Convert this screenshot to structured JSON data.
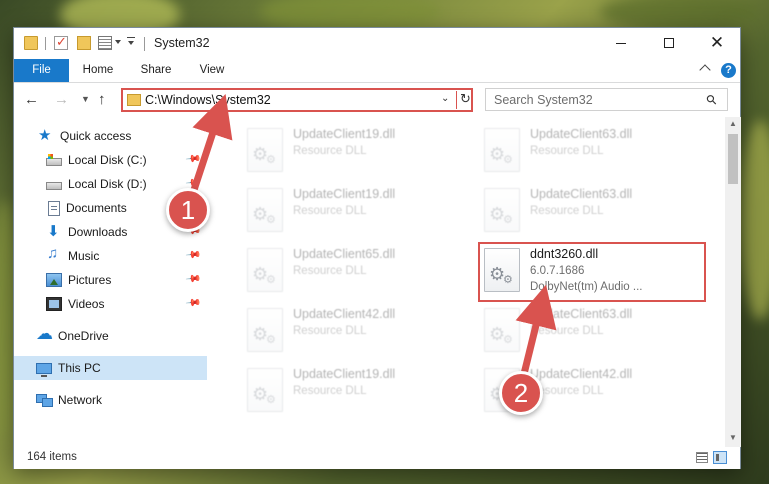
{
  "window": {
    "title": "System32",
    "minimize_label": "—",
    "close_label": "✕"
  },
  "ribbon": {
    "tabs": [
      "File",
      "Home",
      "Share",
      "View"
    ],
    "help_label": "?"
  },
  "nav": {
    "address": "C:\\Windows\\System32",
    "search_placeholder": "Search System32"
  },
  "sidebar": {
    "items": [
      {
        "label": "Quick access",
        "icon": "star-icon",
        "pinned": false
      },
      {
        "label": "Local Disk (C:)",
        "icon": "drive-icon",
        "pinned": true
      },
      {
        "label": "Local Disk (D:)",
        "icon": "drive-icon",
        "pinned": true
      },
      {
        "label": "Documents",
        "icon": "documents-icon",
        "pinned": true
      },
      {
        "label": "Downloads",
        "icon": "downloads-icon",
        "pinned": true
      },
      {
        "label": "Music",
        "icon": "music-icon",
        "pinned": true
      },
      {
        "label": "Pictures",
        "icon": "pictures-icon",
        "pinned": true
      },
      {
        "label": "Videos",
        "icon": "videos-icon",
        "pinned": true
      },
      {
        "label": "OneDrive",
        "icon": "onedrive-icon",
        "pinned": false
      },
      {
        "label": "This PC",
        "icon": "this-pc-icon",
        "pinned": false,
        "selected": true
      },
      {
        "label": "Network",
        "icon": "network-icon",
        "pinned": false
      }
    ]
  },
  "files": [
    {
      "name": "UpdateClient19.dll",
      "type": "Resource DLL",
      "faded": true
    },
    {
      "name": "UpdateClient63.dll",
      "type": "Resource DLL",
      "faded": true
    },
    {
      "name": "UpdateClient19.dll",
      "type": "Resource DLL",
      "faded": true
    },
    {
      "name": "UpdateClient63.dll",
      "type": "Resource DLL",
      "faded": true
    },
    {
      "name": "UpdateClient65.dll",
      "type": "Resource DLL",
      "faded": true
    },
    {
      "name": "ddnt3260.dll",
      "version": "6.0.7.1686",
      "description": "DolbyNet(tm) Audio ...",
      "faded": false,
      "highlighted": true
    },
    {
      "name": "UpdateClient42.dll",
      "type": "Resource DLL",
      "faded": true
    },
    {
      "name": "UpdateClient63.dll",
      "type": "Resource DLL",
      "faded": true
    },
    {
      "name": "UpdateClient19.dll",
      "type": "Resource DLL",
      "faded": true
    },
    {
      "name": "UpdateClient42.dll",
      "type": "Resource DLL",
      "faded": true
    }
  ],
  "status": {
    "item_count": "164 items"
  },
  "annotations": {
    "badge_one": "1",
    "badge_two": "2",
    "color": "#d9534f"
  }
}
